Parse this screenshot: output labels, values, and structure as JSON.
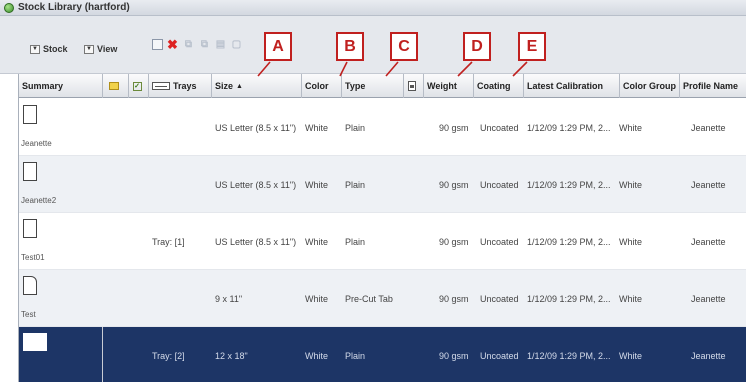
{
  "window": {
    "title": "Stock Library (hartford)"
  },
  "toolbar": {
    "menus": [
      {
        "label": "Stock"
      },
      {
        "label": "View"
      }
    ],
    "icons": [
      "new-stock-icon",
      "delete-icon",
      "copy-icon",
      "paste-icon",
      "properties-icon",
      "export-icon"
    ]
  },
  "annotations": [
    "A",
    "B",
    "C",
    "D",
    "E"
  ],
  "columns": {
    "summary": "Summary",
    "trays": "Trays",
    "size": "Size",
    "color": "Color",
    "type": "Type",
    "weight": "Weight",
    "coating": "Coating",
    "calibration": "Latest Calibration",
    "color_group": "Color Group",
    "profile": "Profile Name"
  },
  "rows": [
    {
      "name": "Jeanette",
      "tray": "",
      "size": "US Letter (8.5 x 11\")",
      "color": "White",
      "type": "Plain",
      "weight": "90 gsm",
      "coating": "Uncoated",
      "calibration": "1/12/09 1:29 PM, 2...",
      "color_group": "White",
      "profile": "Jeanette",
      "icon": "sheet-icon"
    },
    {
      "name": "Jeanette2",
      "tray": "",
      "size": "US Letter (8.5 x 11\")",
      "color": "White",
      "type": "Plain",
      "weight": "90 gsm",
      "coating": "Uncoated",
      "calibration": "1/12/09 1:29 PM, 2...",
      "color_group": "White",
      "profile": "Jeanette",
      "icon": "sheet-icon"
    },
    {
      "name": "Test01",
      "tray": "Tray: [1]",
      "size": "US Letter (8.5 x 11\")",
      "color": "White",
      "type": "Plain",
      "weight": "90 gsm",
      "coating": "Uncoated",
      "calibration": "1/12/09 1:29 PM, 2...",
      "color_group": "White",
      "profile": "Jeanette",
      "icon": "sheet-icon"
    },
    {
      "name": "Test",
      "tray": "",
      "size": "9 x 11\"",
      "color": "White",
      "type": "Pre-Cut Tab",
      "weight": "90 gsm",
      "coating": "Uncoated",
      "calibration": "1/12/09 1:29 PM, 2...",
      "color_group": "White",
      "profile": "Jeanette",
      "icon": "tab-sheet-icon"
    },
    {
      "name": "",
      "tray": "Tray: [2]",
      "size": "12 x 18\"",
      "color": "White",
      "type": "Plain",
      "weight": "90 gsm",
      "coating": "Uncoated",
      "calibration": "1/12/09 1:29 PM, 2...",
      "color_group": "White",
      "profile": "Jeanette",
      "icon": "wide-sheet-icon"
    }
  ],
  "colors": {
    "selected_row": "#1d3566",
    "annotation": "#c0201f"
  }
}
